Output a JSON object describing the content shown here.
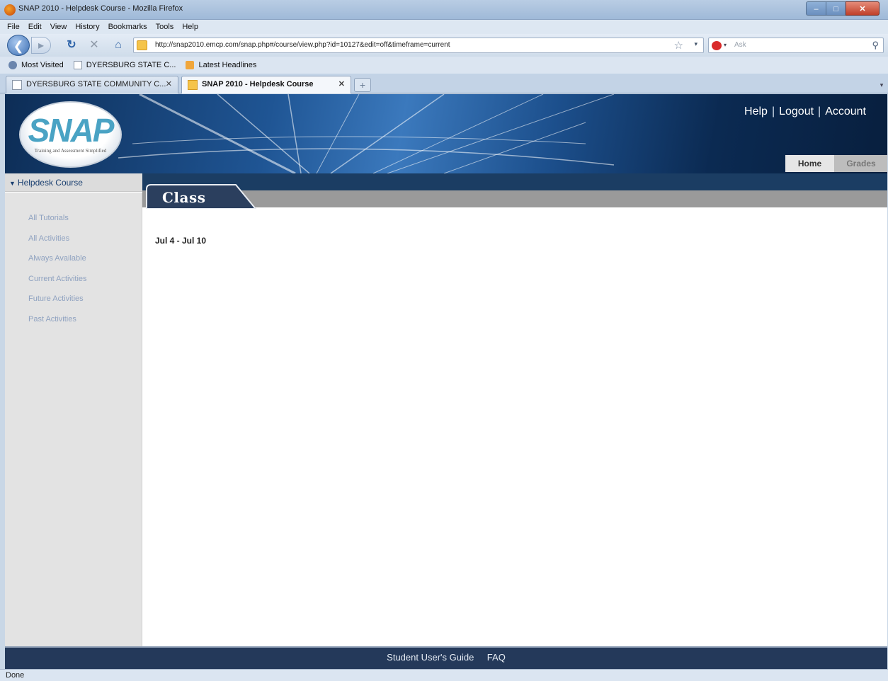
{
  "window": {
    "title": "SNAP 2010 - Helpdesk Course - Mozilla Firefox"
  },
  "menu": [
    "File",
    "Edit",
    "View",
    "History",
    "Bookmarks",
    "Tools",
    "Help"
  ],
  "navigation": {
    "url": "http://snap2010.emcp.com/snap.php#/course/view.php?id=10127&edit=off&timeframe=current",
    "search_placeholder": "Ask"
  },
  "bookmarks": [
    "Most Visited",
    "DYERSBURG STATE C...",
    "Latest Headlines"
  ],
  "tabs": [
    {
      "label": "DYERSBURG STATE COMMUNITY C...",
      "active": false
    },
    {
      "label": "SNAP 2010 - Helpdesk Course",
      "active": true
    }
  ],
  "page": {
    "logo": {
      "word": "SNAP",
      "tagline": "Training and Assessment Simplified"
    },
    "top_links": [
      "Help",
      "Logout",
      "Account"
    ],
    "top_link_separator": "|",
    "nav_tabs": [
      "Home",
      "Grades"
    ],
    "course_name": "Helpdesk Course",
    "sidebar_items": [
      "All Tutorials",
      "All Activities",
      "Always Available",
      "Current Activities",
      "Future Activities",
      "Past Activities"
    ],
    "section_title": "Class",
    "date_range": "Jul 4 - Jul 10",
    "footer_links": [
      "Student User's Guide",
      "FAQ"
    ]
  },
  "status": {
    "text": "Done"
  },
  "colors": {
    "banner_dark": "#0d2d56",
    "banner_light": "#3b79bd",
    "sidebar_link": "#8fa2c0",
    "footer_bg": "#24395a",
    "class_tab": "#2b3f5e"
  }
}
